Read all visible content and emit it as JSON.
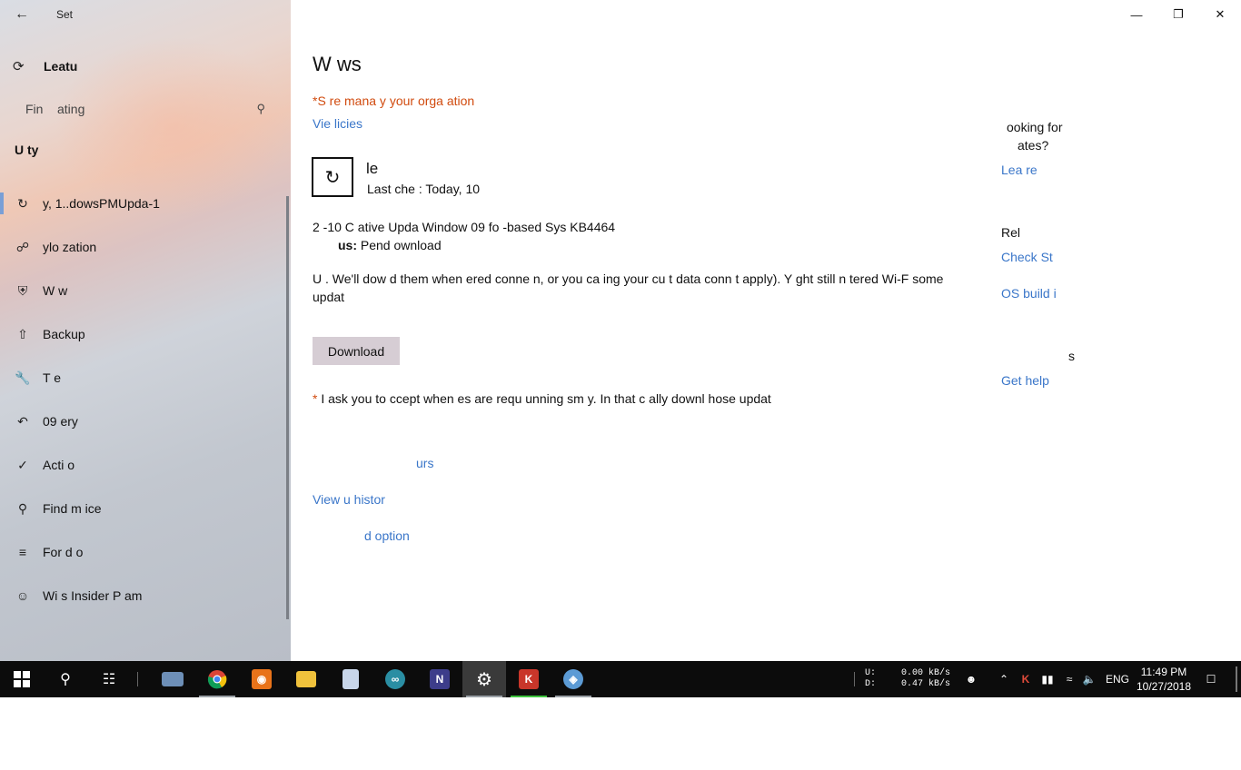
{
  "window": {
    "app_title": "Set",
    "controls": {
      "minimize_icon": "minimize-icon",
      "maximize_icon": "restore-icon",
      "close_icon": "close-icon"
    }
  },
  "sidebar": {
    "home_label": "Leatu",
    "search_placeholder": "Fin    ating",
    "section_title": "U                     ty",
    "items": [
      {
        "icon": "update-icon",
        "label": "y, 1..dowsPMUpda-1"
      },
      {
        "icon": "delivery-optimization-icon",
        "label": "ylo       zation"
      },
      {
        "icon": "shield-icon",
        "label": "W        w"
      },
      {
        "icon": "backup-icon",
        "label": "Backup"
      },
      {
        "icon": "wrench-icon",
        "label": "T      e"
      },
      {
        "icon": "recovery-icon",
        "label": "09   ery"
      },
      {
        "icon": "activation-icon",
        "label": "Acti     o"
      },
      {
        "icon": "find-device-icon",
        "label": "Find m       ice"
      },
      {
        "icon": "developers-icon",
        "label": "For d     o"
      },
      {
        "icon": "insider-icon",
        "label": "Wi      s Insider P      am"
      }
    ]
  },
  "main": {
    "title": "W          ws",
    "org_notice": "*S                       re mana          y your orga         ation",
    "view_policies": "Vie                               licies",
    "status_title": "le",
    "last_checked": "Last che        : Today, 10",
    "update_name": "2    -10 C          ative Upda        Window                       09 fo        -based Sys         KB4464",
    "update_status_label": "us:",
    "update_status_value": "Pend     ownload",
    "description": "U                      . We'll dow        d them when                             ered conne       n, or you ca                    ing your cu       t data conn                            t apply). Y        ght still n                tered Wi-F        some updat",
    "download_button": "Download",
    "restart_star": "*",
    "restart_note": "     I ask you to                                  ccept when           es are requ                                     unning sm       y. In that c                          ally downl        hose updat",
    "link_active_hours": "urs",
    "link_history": "View u        histor",
    "link_advanced": "d option"
  },
  "right_column": {
    "looking_for": "ooking for",
    "updates_q": "ates?",
    "learn_more": "Lea          re",
    "related": "Rel",
    "check_storage": "Check St",
    "os_build": "OS build i",
    "questions": "s",
    "get_help": "Get help"
  },
  "taskbar": {
    "apps": [
      {
        "name": "start",
        "icon": "windows-icon"
      },
      {
        "name": "search",
        "icon": "search-icon"
      },
      {
        "name": "task-view",
        "icon": "task-view-icon"
      },
      {
        "name": "pc",
        "icon": "computer-icon"
      },
      {
        "name": "chrome",
        "icon": "chrome-icon",
        "color": "#e8b317"
      },
      {
        "name": "ideas",
        "icon": "lightbulb-icon",
        "color": "#e8731a"
      },
      {
        "name": "explorer",
        "icon": "folder-icon",
        "color": "#f0c23c"
      },
      {
        "name": "notepad",
        "icon": "notepad-icon",
        "color": "#c8d6ea"
      },
      {
        "name": "arduino",
        "icon": "arduino-icon",
        "color": "#2a8ea3"
      },
      {
        "name": "onenote",
        "icon": "onenote-icon",
        "color": "#3d3d8a"
      },
      {
        "name": "settings",
        "icon": "gear-icon"
      },
      {
        "name": "kaspersky",
        "icon": "kaspersky-icon",
        "color": "#c9362a"
      },
      {
        "name": "paint",
        "icon": "palette-icon",
        "color": "#5c9bd5"
      }
    ],
    "net_upload_label": "U:",
    "net_download_label": "D:",
    "net_upload_value": "0.00 kB/s",
    "net_download_value": "0.47 kB/s",
    "language": "ENG",
    "time": "11:49 PM",
    "date": "10/27/2018"
  }
}
